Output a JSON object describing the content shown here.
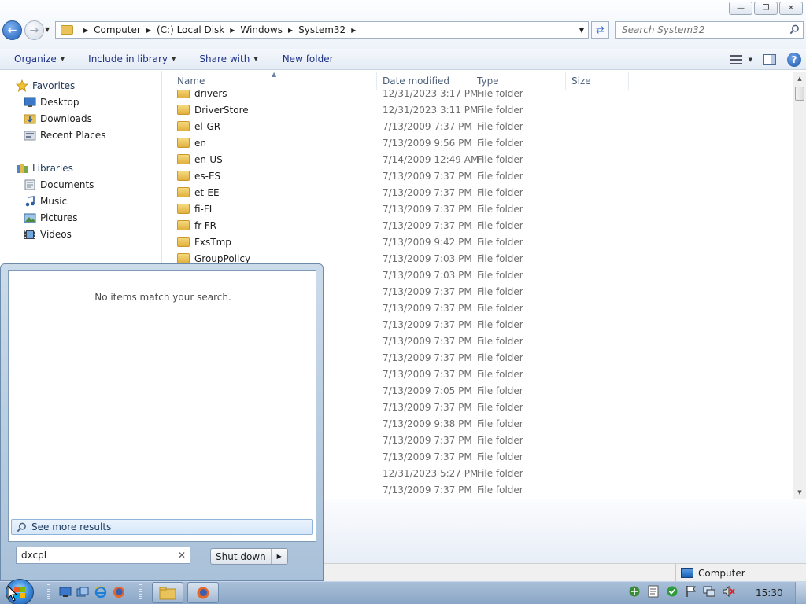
{
  "window": {
    "breadcrumbs": [
      "Computer",
      "(C:) Local Disk",
      "Windows",
      "System32"
    ],
    "search_placeholder": "Search System32"
  },
  "toolbar": {
    "organize": "Organize",
    "include_in_library": "Include in library",
    "share_with": "Share with",
    "new_folder": "New folder"
  },
  "navpane": {
    "favorites": {
      "label": "Favorites",
      "items": [
        "Desktop",
        "Downloads",
        "Recent Places"
      ]
    },
    "libraries": {
      "label": "Libraries",
      "items": [
        "Documents",
        "Music",
        "Pictures",
        "Videos"
      ]
    }
  },
  "columns": {
    "name": "Name",
    "date_modified": "Date modified",
    "type": "Type",
    "size": "Size"
  },
  "files": [
    {
      "name": "drivers",
      "date": "12/31/2023 3:17 PM",
      "type": "File folder"
    },
    {
      "name": "DriverStore",
      "date": "12/31/2023 3:11 PM",
      "type": "File folder"
    },
    {
      "name": "el-GR",
      "date": "7/13/2009 7:37 PM",
      "type": "File folder"
    },
    {
      "name": "en",
      "date": "7/13/2009 9:56 PM",
      "type": "File folder"
    },
    {
      "name": "en-US",
      "date": "7/14/2009 12:49 AM",
      "type": "File folder"
    },
    {
      "name": "es-ES",
      "date": "7/13/2009 7:37 PM",
      "type": "File folder"
    },
    {
      "name": "et-EE",
      "date": "7/13/2009 7:37 PM",
      "type": "File folder"
    },
    {
      "name": "fi-FI",
      "date": "7/13/2009 7:37 PM",
      "type": "File folder"
    },
    {
      "name": "fr-FR",
      "date": "7/13/2009 7:37 PM",
      "type": "File folder"
    },
    {
      "name": "FxsTmp",
      "date": "7/13/2009 9:42 PM",
      "type": "File folder"
    },
    {
      "name": "GroupPolicy",
      "date": "7/13/2009 7:03 PM",
      "type": "File folder"
    },
    {
      "name": "",
      "date": "7/13/2009 7:03 PM",
      "type": "File folder"
    },
    {
      "name": "",
      "date": "7/13/2009 7:37 PM",
      "type": "File folder"
    },
    {
      "name": "",
      "date": "7/13/2009 7:37 PM",
      "type": "File folder"
    },
    {
      "name": "",
      "date": "7/13/2009 7:37 PM",
      "type": "File folder"
    },
    {
      "name": "",
      "date": "7/13/2009 7:37 PM",
      "type": "File folder"
    },
    {
      "name": "",
      "date": "7/13/2009 7:37 PM",
      "type": "File folder"
    },
    {
      "name": "",
      "date": "7/13/2009 7:37 PM",
      "type": "File folder"
    },
    {
      "name": "",
      "date": "7/13/2009 7:05 PM",
      "type": "File folder"
    },
    {
      "name": "",
      "date": "7/13/2009 7:37 PM",
      "type": "File folder"
    },
    {
      "name": "",
      "date": "7/13/2009 9:38 PM",
      "type": "File folder"
    },
    {
      "name": "",
      "date": "7/13/2009 7:37 PM",
      "type": "File folder"
    },
    {
      "name": "",
      "date": "7/13/2009 7:37 PM",
      "type": "File folder"
    },
    {
      "name": "",
      "date": "12/31/2023 5:27 PM",
      "type": "File folder"
    },
    {
      "name": "",
      "date": "7/13/2009 7:37 PM",
      "type": "File folder"
    }
  ],
  "statusbar": {
    "location": "Computer"
  },
  "startmenu": {
    "no_items": "No items match your search.",
    "see_more": "See more results",
    "search_value": "dxcpl",
    "shutdown": "Shut down"
  },
  "taskbar": {
    "clock": "15:30"
  }
}
